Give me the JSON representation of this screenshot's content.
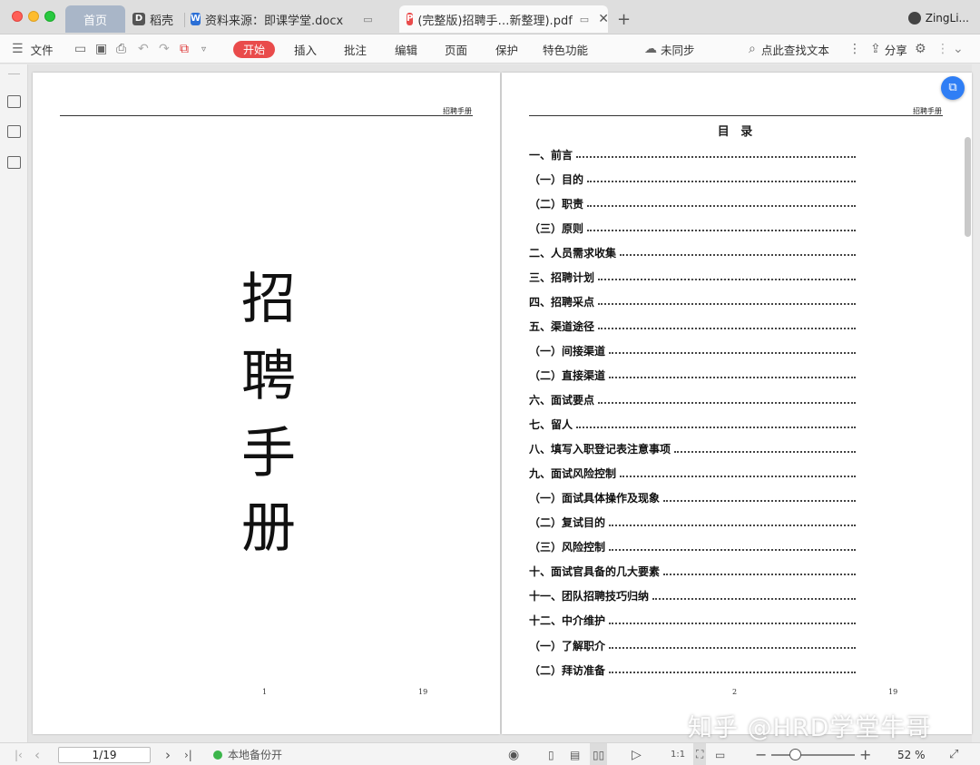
{
  "titlebar": {
    "tabs": [
      {
        "label": "首页"
      },
      {
        "label": "稻壳"
      },
      {
        "label": "资料来源：即课学堂.docx"
      },
      {
        "label": "(完整版)招聘手…新整理).pdf"
      }
    ],
    "user_name": "ZingLi..."
  },
  "toolbar": {
    "file_label": "文件",
    "menu_items": [
      "开始",
      "插入",
      "批注",
      "编辑",
      "页面",
      "保护",
      "特色功能"
    ],
    "sync_label": "未同步",
    "search_label": "点此查找文本",
    "share_label": "分享"
  },
  "document": {
    "header_text": "招聘手册",
    "cover_title_chars": [
      "招",
      "聘",
      "手",
      "册"
    ],
    "left_page": {
      "page_number": "1",
      "total_pages": "19"
    },
    "right_page": {
      "page_number": "2",
      "total_pages": "19"
    },
    "toc_title": "目  录",
    "toc_items": [
      "一、前言",
      "（一）目的",
      "（二）职责",
      "（三）原则",
      "二、人员需求收集",
      "三、招聘计划",
      "四、招聘采点",
      "五、渠道途径",
      "（一）间接渠道",
      "（二）直接渠道",
      "六、面试要点",
      "七、留人",
      "八、填写入职登记表注意事项",
      "九、面试风险控制",
      "（一）面试具体操作及现象",
      "（二）复试目的",
      "（三）风险控制",
      "十、面试官具备的几大要素",
      "十一、团队招聘技巧归纳",
      "十二、中介维护",
      "（一）了解职介",
      "（二）拜访准备"
    ],
    "watermark": "知乎 @HRD学堂牛哥"
  },
  "statusbar": {
    "page_indicator": "1/19",
    "backup_label": "本地备份开",
    "zoom_label": "52 %",
    "zoom_fraction": 0.52
  }
}
